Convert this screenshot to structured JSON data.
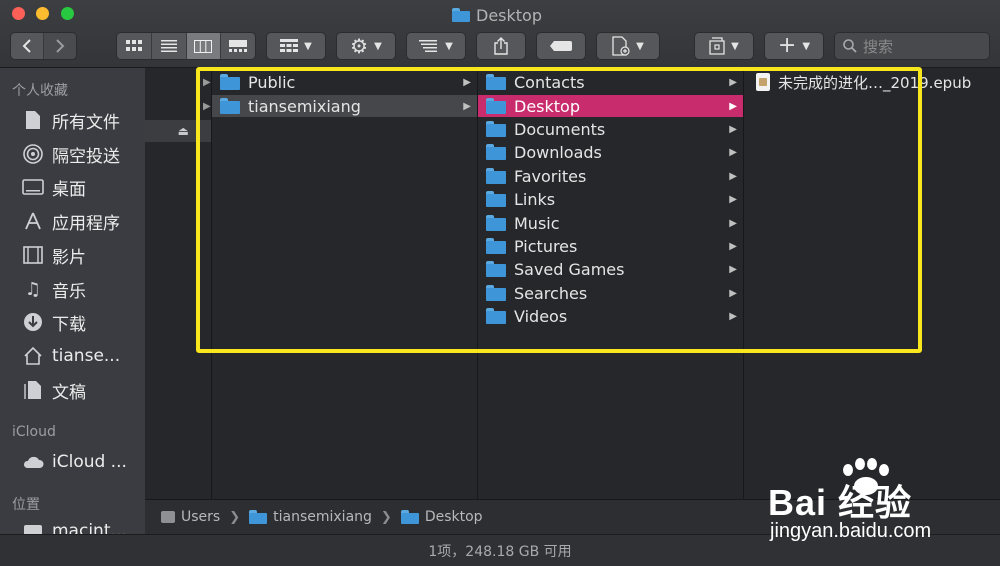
{
  "window": {
    "title": "Desktop"
  },
  "toolbar": {
    "search_placeholder": "搜索"
  },
  "sidebar": {
    "favorites_heading": "个人收藏",
    "favorites": [
      {
        "label": "所有文件",
        "icon": "all-files-icon"
      },
      {
        "label": "隔空投送",
        "icon": "airdrop-icon"
      },
      {
        "label": "桌面",
        "icon": "desktop-icon"
      },
      {
        "label": "应用程序",
        "icon": "applications-icon"
      },
      {
        "label": "影片",
        "icon": "movies-icon"
      },
      {
        "label": "音乐",
        "icon": "music-icon"
      },
      {
        "label": "下载",
        "icon": "downloads-icon"
      },
      {
        "label": "tianse...",
        "icon": "home-icon"
      },
      {
        "label": "文稿",
        "icon": "documents-icon"
      }
    ],
    "icloud_heading": "iCloud",
    "icloud": [
      {
        "label": "iCloud ...",
        "icon": "cloud-icon"
      }
    ],
    "locations_heading": "位置",
    "locations": [
      {
        "label": "macint...",
        "icon": "disk-icon"
      }
    ]
  },
  "columns": {
    "users": [
      {
        "name": "Public",
        "selected": false
      },
      {
        "name": "tiansemixiang",
        "selected": true
      }
    ],
    "home": [
      {
        "name": "Contacts"
      },
      {
        "name": "Desktop",
        "selected": true
      },
      {
        "name": "Documents"
      },
      {
        "name": "Downloads"
      },
      {
        "name": "Favorites"
      },
      {
        "name": "Links"
      },
      {
        "name": "Music"
      },
      {
        "name": "Pictures"
      },
      {
        "name": "Saved Games"
      },
      {
        "name": "Searches"
      },
      {
        "name": "Videos"
      }
    ],
    "desktop": [
      {
        "name": "未完成的进化…_2019.epub"
      }
    ]
  },
  "pathbar": {
    "segments": [
      "Users",
      "tiansemixiang",
      "Desktop"
    ]
  },
  "statusbar": {
    "text": "1项，248.18 GB 可用"
  },
  "watermark": {
    "brand": "Bai 经验",
    "sub": "jingyan.baidu.com"
  },
  "colors": {
    "selection_pink": "#c82c6c",
    "highlight_yellow": "#f8e71c",
    "folder_blue": "#3e96d8"
  }
}
